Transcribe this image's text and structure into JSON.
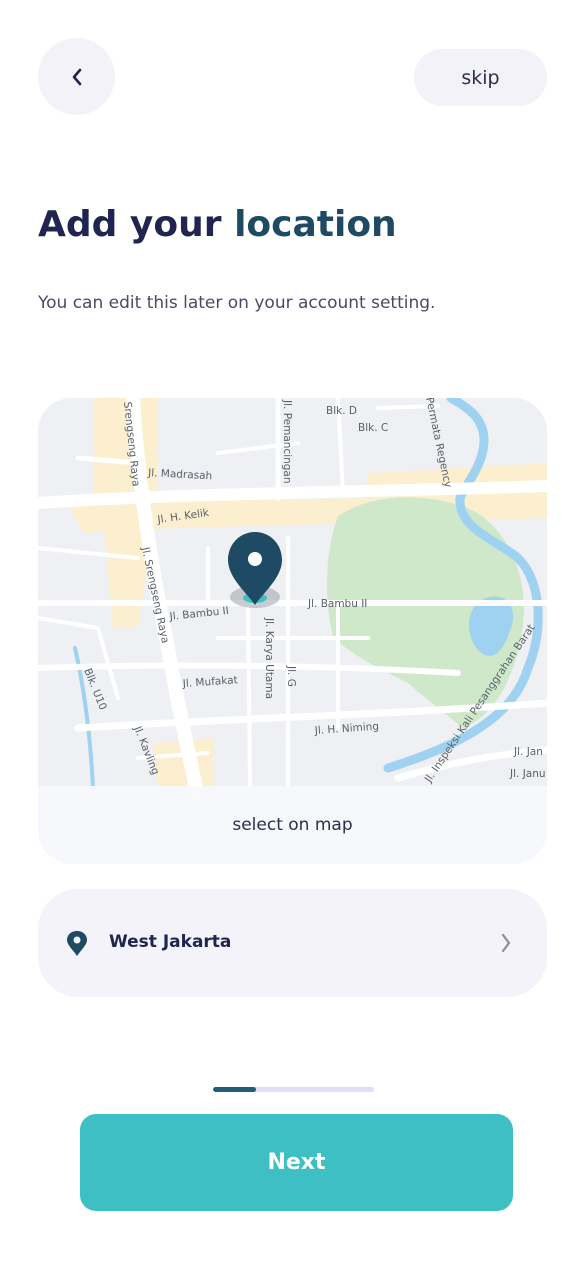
{
  "header": {
    "back_icon": "chevron-left-icon",
    "skip_label": "skip"
  },
  "title": {
    "prefix": "Add your ",
    "highlight": "location"
  },
  "subtitle": "You can edit this later on your account setting.",
  "map": {
    "select_label": "select on map",
    "pin_icon": "map-pin-icon",
    "street_labels": {
      "srengseng_raya": "Srengseng Raya",
      "jl_madrasah": "Jl. Madrasah",
      "jl_pemancingan": "Jl. Pemancingan",
      "blk_d": "Blk. D",
      "blk_c": "Blk. C",
      "permata_regency": "Permata Regency",
      "jl_h_kelik": "Jl. H. Kelik",
      "jl_srengseng_raya": "Jl. Srengseng Raya",
      "jl_bambu_ii_left": "Jl. Bambu II",
      "jl_bambu_ii_right": "Jl. Bambu II",
      "jl_karya_utama": "Jl. Karya Utama",
      "jl_g": "Jl. G",
      "jl_mufakat": "Jl. Mufakat",
      "blk_u10": "Blk. U10",
      "jl_kavling": "Jl. Kavling",
      "jl_h_niming": "Jl. H. Niming",
      "jl_inspeksi": "Jl. Inspeksi Kali Pesanggrahan Barat",
      "jl_jan": "Jl. Jan",
      "jl_janu": "Jl. Janu"
    },
    "colors": {
      "land": "#eef0f3",
      "road": "#ffffff",
      "highlight_area": "#fbefcf",
      "park": "#cfe8c9",
      "water": "#9fd1f0",
      "pin": "#1f4a63",
      "pin_halo": "#3dbfc4"
    }
  },
  "location": {
    "pin_icon": "map-pin-icon",
    "label": "West Jakarta",
    "chevron_icon": "chevron-right-icon"
  },
  "progress": {
    "fraction": 0.27
  },
  "next_label": "Next",
  "colors": {
    "accent": "#3dbfc4",
    "primary_dark": "#1f4a63",
    "surface": "#f2f2f8"
  }
}
